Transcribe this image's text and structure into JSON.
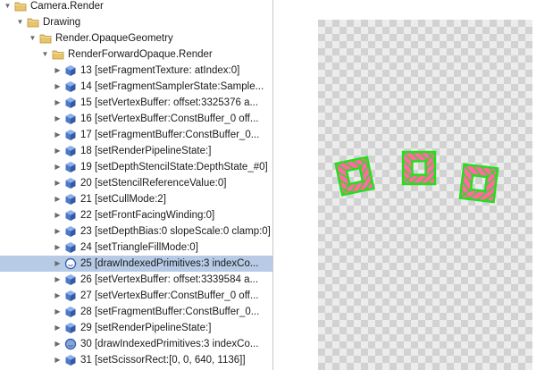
{
  "tree": {
    "items": [
      {
        "label": "Camera.Render",
        "icon": "folder-icon",
        "indent": 0,
        "expanded": true,
        "selected": false
      },
      {
        "label": "Drawing",
        "icon": "folder-icon",
        "indent": 1,
        "expanded": true,
        "selected": false
      },
      {
        "label": "Render.OpaqueGeometry",
        "icon": "folder-icon",
        "indent": 2,
        "expanded": true,
        "selected": false
      },
      {
        "label": "RenderForwardOpaque.Render",
        "icon": "folder-icon",
        "indent": 3,
        "expanded": true,
        "selected": false
      },
      {
        "label": "13 [setFragmentTexture: atIndex:0]",
        "icon": "cube-icon",
        "indent": 4,
        "expanded": false,
        "selected": false
      },
      {
        "label": "14 [setFragmentSamplerState:Sample...",
        "icon": "cube-icon",
        "indent": 4,
        "expanded": false,
        "selected": false
      },
      {
        "label": "15 [setVertexBuffer: offset:3325376 a...",
        "icon": "cube-icon",
        "indent": 4,
        "expanded": false,
        "selected": false
      },
      {
        "label": "16 [setVertexBuffer:ConstBuffer_0 off...",
        "icon": "cube-icon",
        "indent": 4,
        "expanded": false,
        "selected": false
      },
      {
        "label": "17 [setFragmentBuffer:ConstBuffer_0...",
        "icon": "cube-icon",
        "indent": 4,
        "expanded": false,
        "selected": false
      },
      {
        "label": "18 [setRenderPipelineState:]",
        "icon": "cube-icon",
        "indent": 4,
        "expanded": false,
        "selected": false
      },
      {
        "label": "19 [setDepthStencilState:DepthState_#0]",
        "icon": "cube-icon",
        "indent": 4,
        "expanded": false,
        "selected": false
      },
      {
        "label": "20 [setStencilReferenceValue:0]",
        "icon": "cube-icon",
        "indent": 4,
        "expanded": false,
        "selected": false
      },
      {
        "label": "21 [setCullMode:2]",
        "icon": "cube-icon",
        "indent": 4,
        "expanded": false,
        "selected": false
      },
      {
        "label": "22 [setFrontFacingWinding:0]",
        "icon": "cube-icon",
        "indent": 4,
        "expanded": false,
        "selected": false
      },
      {
        "label": "23 [setDepthBias:0 slopeScale:0 clamp:0]",
        "icon": "cube-icon",
        "indent": 4,
        "expanded": false,
        "selected": false
      },
      {
        "label": "24 [setTriangleFillMode:0]",
        "icon": "cube-icon",
        "indent": 4,
        "expanded": false,
        "selected": false
      },
      {
        "label": "25 [drawIndexedPrimitives:3 indexCo...",
        "icon": "draw-call-icon",
        "indent": 4,
        "expanded": false,
        "selected": true
      },
      {
        "label": "26 [setVertexBuffer: offset:3339584 a...",
        "icon": "cube-icon",
        "indent": 4,
        "expanded": false,
        "selected": false
      },
      {
        "label": "27 [setVertexBuffer:ConstBuffer_0 off...",
        "icon": "cube-icon",
        "indent": 4,
        "expanded": false,
        "selected": false
      },
      {
        "label": "28 [setFragmentBuffer:ConstBuffer_0...",
        "icon": "cube-icon",
        "indent": 4,
        "expanded": false,
        "selected": false
      },
      {
        "label": "29 [setRenderPipelineState:]",
        "icon": "cube-icon",
        "indent": 4,
        "expanded": false,
        "selected": false
      },
      {
        "label": "30 [drawIndexedPrimitives:3 indexCo...",
        "icon": "draw-call-icon",
        "indent": 4,
        "expanded": false,
        "selected": false
      },
      {
        "label": "31 [setScissorRect:[0, 0, 640, 1136]]",
        "icon": "cube-icon",
        "indent": 4,
        "expanded": false,
        "selected": false
      }
    ]
  },
  "preview": {
    "background": "transparent-checkerboard",
    "objects": [
      {
        "name": "wireframe-quad",
        "color": "#22e01c"
      },
      {
        "name": "wireframe-quad",
        "color": "#22e01c"
      },
      {
        "name": "wireframe-quad",
        "color": "#22e01c"
      }
    ]
  },
  "colors": {
    "selection": "#b7cbe6",
    "wireframe": "#22e01c",
    "wireframe_inner": "#ff6aa0",
    "checker_light": "#ececec",
    "checker_dark": "#d2d2d2",
    "folder": "#e8c56a",
    "cube": "#4d79c7"
  }
}
